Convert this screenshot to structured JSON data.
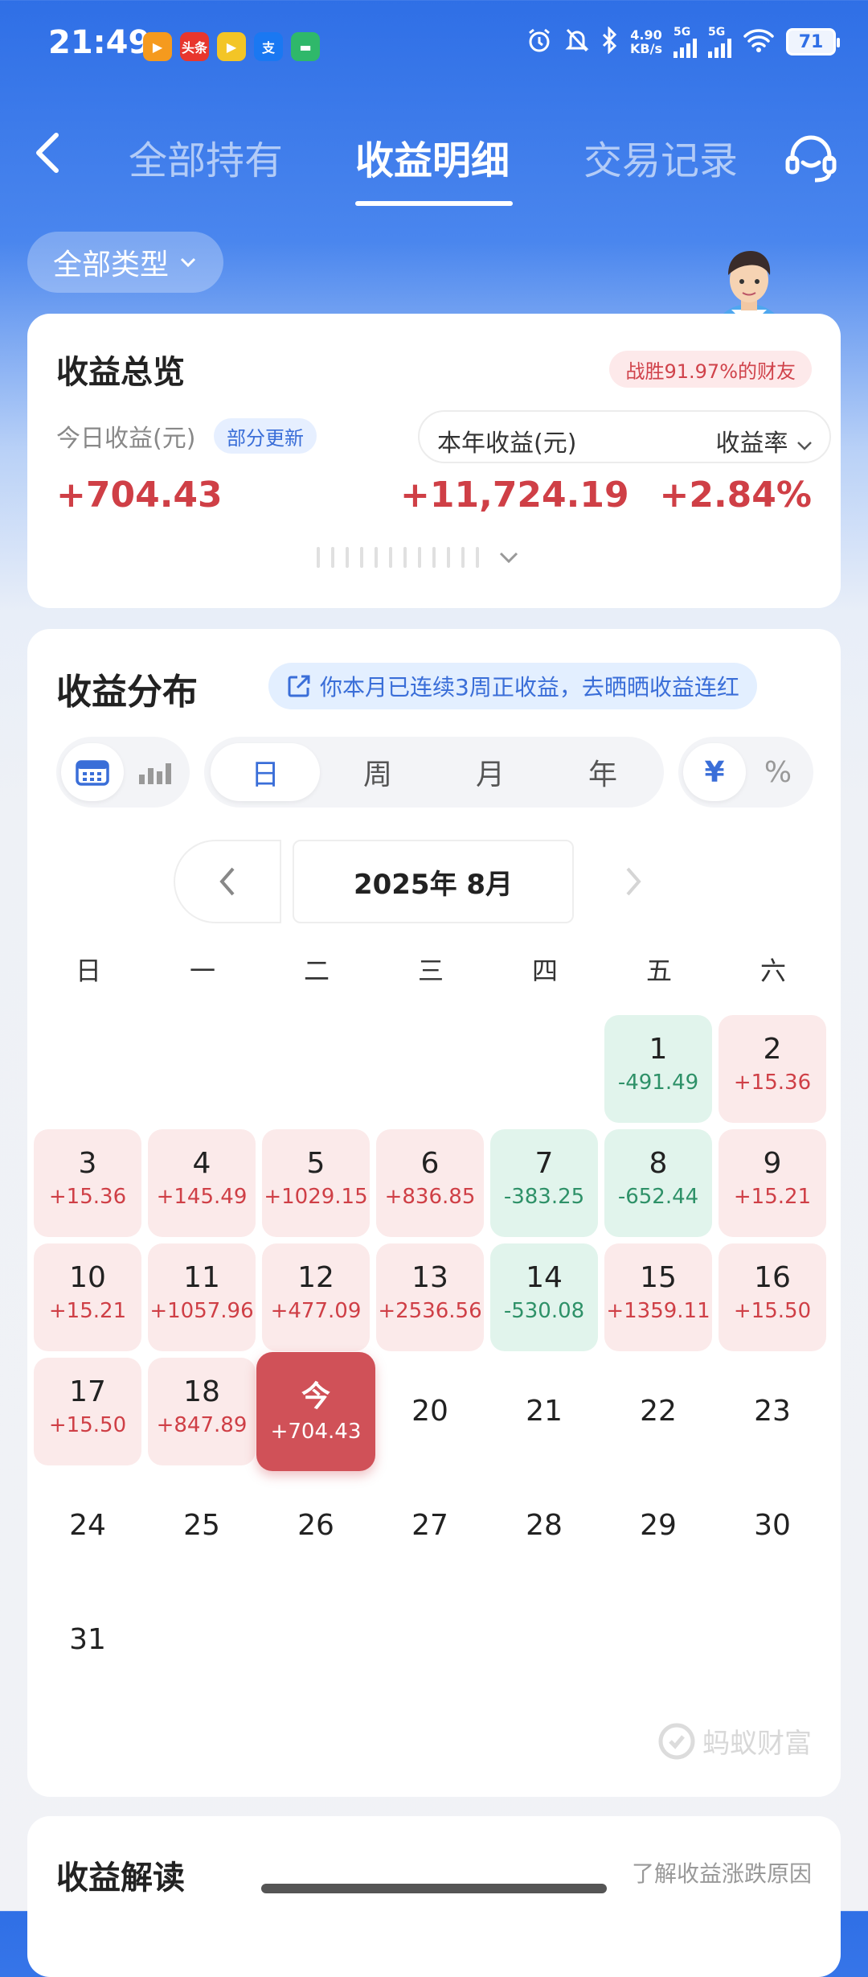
{
  "status_bar": {
    "time": "21:49",
    "app_icons": [
      {
        "name": "video-app-icon",
        "text": "▶",
        "color": "#f59a1e"
      },
      {
        "name": "toutiao-app-icon",
        "text": "头条",
        "color": "#e8362d"
      },
      {
        "name": "media-app-icon",
        "text": "▶",
        "color": "#f3c526"
      },
      {
        "name": "alipay-app-icon",
        "text": "支",
        "color": "#1a78f2"
      },
      {
        "name": "card-app-icon",
        "text": "▬",
        "color": "#2fb86a"
      }
    ],
    "net_speed": "4.90",
    "net_unit": "KB/s",
    "signal1_label": "5G",
    "signal2_label": "5G",
    "battery": "71"
  },
  "nav": {
    "tabs": [
      "全部持有",
      "收益明细",
      "交易记录"
    ],
    "active_tab": "收益明细"
  },
  "filter": {
    "label": "全部类型"
  },
  "overview": {
    "title": "收益总览",
    "beat_badge": "战胜91.97%的财友",
    "today_label": "今日收益(元)",
    "partial_badge": "部分更新",
    "year_label": "本年收益(元)",
    "rate_label": "收益率",
    "today_value": "+704.43",
    "year_value": "+11,724.19",
    "rate_value": "+2.84%"
  },
  "distribution": {
    "title": "收益分布",
    "streak_text": "你本月已连续3周正收益，去晒晒收益连红",
    "period_tabs": [
      "日",
      "周",
      "月",
      "年"
    ],
    "active_period": "日",
    "unit_tabs": [
      "¥",
      "%"
    ],
    "active_unit": "¥",
    "month": "2025年 8月",
    "weekdays": [
      "日",
      "一",
      "二",
      "三",
      "四",
      "五",
      "六"
    ],
    "first_weekday": 5,
    "days": [
      {
        "day": "1",
        "value": "-491.49",
        "kind": "neg"
      },
      {
        "day": "2",
        "value": "+15.36",
        "kind": "pos"
      },
      {
        "day": "3",
        "value": "+15.36",
        "kind": "pos"
      },
      {
        "day": "4",
        "value": "+145.49",
        "kind": "pos"
      },
      {
        "day": "5",
        "value": "+1029.15",
        "kind": "pos"
      },
      {
        "day": "6",
        "value": "+836.85",
        "kind": "pos"
      },
      {
        "day": "7",
        "value": "-383.25",
        "kind": "neg"
      },
      {
        "day": "8",
        "value": "-652.44",
        "kind": "neg"
      },
      {
        "day": "9",
        "value": "+15.21",
        "kind": "pos"
      },
      {
        "day": "10",
        "value": "+15.21",
        "kind": "pos"
      },
      {
        "day": "11",
        "value": "+1057.96",
        "kind": "pos"
      },
      {
        "day": "12",
        "value": "+477.09",
        "kind": "pos"
      },
      {
        "day": "13",
        "value": "+2536.56",
        "kind": "pos"
      },
      {
        "day": "14",
        "value": "-530.08",
        "kind": "neg"
      },
      {
        "day": "15",
        "value": "+1359.11",
        "kind": "pos"
      },
      {
        "day": "16",
        "value": "+15.50",
        "kind": "pos"
      },
      {
        "day": "17",
        "value": "+15.50",
        "kind": "pos"
      },
      {
        "day": "18",
        "value": "+847.89",
        "kind": "pos"
      },
      {
        "day": "今",
        "value": "+704.43",
        "kind": "today"
      },
      {
        "day": "20",
        "value": "",
        "kind": "future"
      },
      {
        "day": "21",
        "value": "",
        "kind": "future"
      },
      {
        "day": "22",
        "value": "",
        "kind": "future"
      },
      {
        "day": "23",
        "value": "",
        "kind": "future"
      },
      {
        "day": "24",
        "value": "",
        "kind": "future"
      },
      {
        "day": "25",
        "value": "",
        "kind": "future"
      },
      {
        "day": "26",
        "value": "",
        "kind": "future"
      },
      {
        "day": "27",
        "value": "",
        "kind": "future"
      },
      {
        "day": "28",
        "value": "",
        "kind": "future"
      },
      {
        "day": "29",
        "value": "",
        "kind": "future"
      },
      {
        "day": "30",
        "value": "",
        "kind": "future"
      },
      {
        "day": "31",
        "value": "",
        "kind": "future"
      }
    ],
    "watermark": "蚂蚁财富"
  },
  "next_section": {
    "title": "收益解读",
    "link": "了解收益涨跌原因"
  }
}
